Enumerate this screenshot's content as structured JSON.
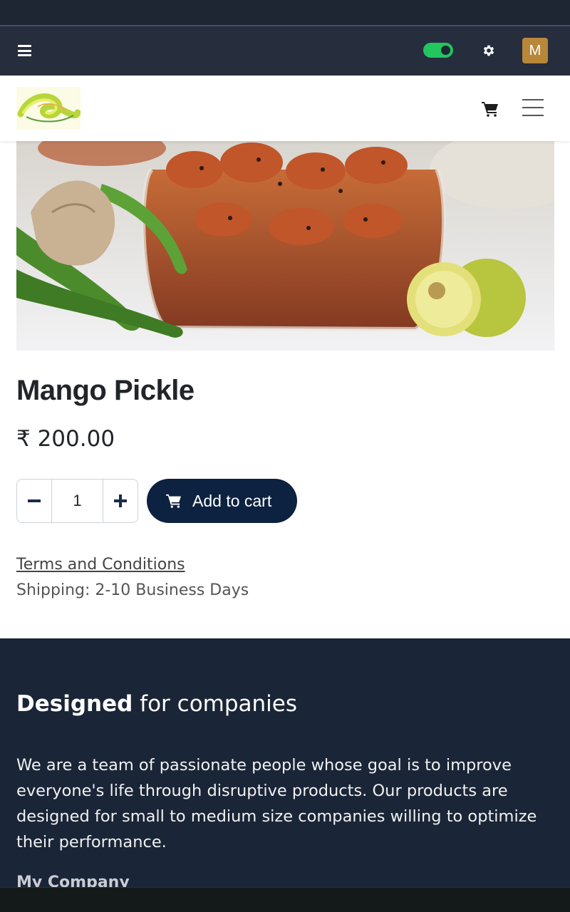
{
  "admin_bar": {
    "avatar_letter": "M",
    "toggle_color": "#22c55e",
    "avatar_color": "#b8873a",
    "icons": [
      "menu-icon",
      "toggle-switch",
      "gear-icon",
      "avatar"
    ]
  },
  "header": {
    "icons": [
      "logo",
      "cart-icon",
      "menu-toggle-icon"
    ]
  },
  "product": {
    "title": "Mango Pickle",
    "price": "₹ 200.00",
    "quantity": "1",
    "add_to_cart_label": "Add to cart",
    "terms_label": "Terms and Conditions",
    "shipping": "Shipping: 2-10 Business Days",
    "button_color": "#0d2240"
  },
  "footer": {
    "heading_bold": "Designed",
    "heading_rest": " for companies",
    "text": "We are a team of passionate people whose goal is to improve everyone's life through disruptive products. Our products are designed for small to medium size companies willing to optimize their performance.",
    "company": "My Company",
    "bg_color": "#1a2537"
  }
}
